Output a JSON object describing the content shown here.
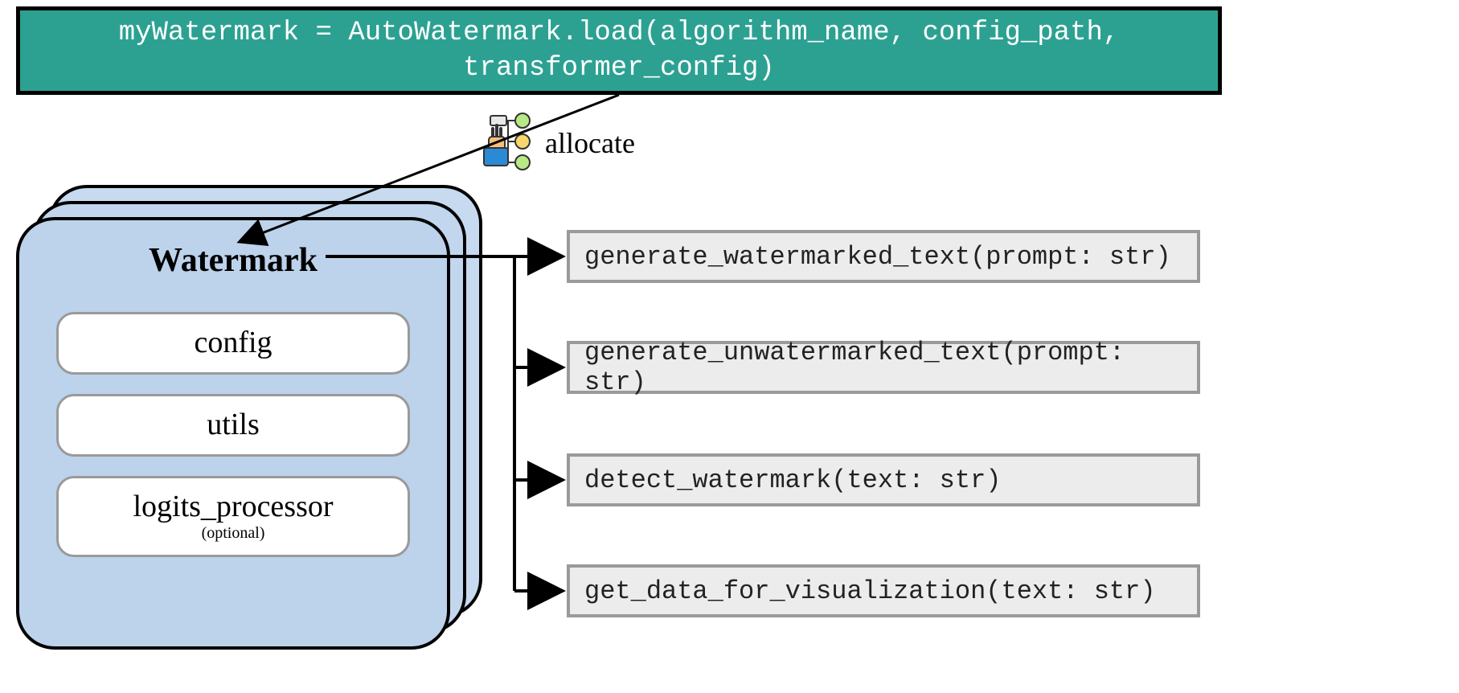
{
  "banner": {
    "code": "myWatermark = AutoWatermark.load(algorithm_name, config_path, transformer_config)"
  },
  "allocate_label": "allocate",
  "watermark_card": {
    "title": "Watermark",
    "items": {
      "config": "config",
      "utils": "utils",
      "logits_processor": "logits_processor",
      "logits_optional": "(optional)"
    }
  },
  "methods": {
    "m1": "generate_watermarked_text(prompt: str)",
    "m2": "generate_unwatermarked_text(prompt: str)",
    "m3": "detect_watermark(text: str)",
    "m4": "get_data_for_visualization(text: str)"
  }
}
